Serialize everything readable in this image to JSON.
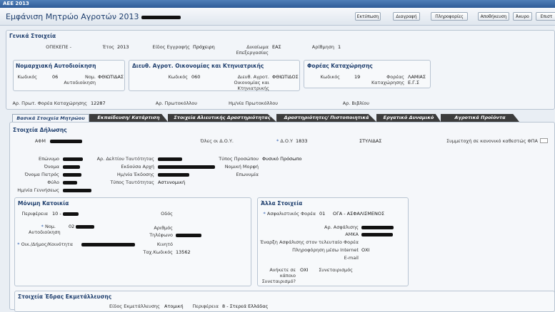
{
  "app": {
    "title": "ΑΕΕ 2013"
  },
  "page": {
    "title": "Εμφάνιση Μητρώο Αγροτών 2013"
  },
  "toolbar": {
    "print": "Εκτύπωση",
    "delete": "Διαγραφή",
    "info": "Πληροφορίες",
    "save": "Αποθήκευση",
    "cancel": "Άκυρο",
    "back": "Επιστ"
  },
  "general": {
    "title": "Γενικά Στοιχεία",
    "opekepe": "ΟΠΕΚΕΠΕ -",
    "year_label": "Έτος",
    "year": "2013",
    "reg_type_label": "Είδος Εγγραφής",
    "reg_type": "Πρόχειρη",
    "processing_right_label": "Δικαίωμα Επεξεργασίας",
    "processing_right": "ΕΑΣ",
    "number_label": "Αρίθμηση",
    "number": "1",
    "prefecture_box_title": "Νομαρχιακή Αυτοδιοίκηση",
    "code_label": "Κωδικός",
    "prefecture_code": "06",
    "prefecture_name_label": "Νομ. Αυτοδιοίκηση",
    "prefecture_name": "ΦΘΙΩΤΙΔΑΣ",
    "directorate_box_title": "Διευθ. Αγροτ. Οικονομίας και Κτηνιατρικής",
    "directorate_code": "060",
    "directorate_name_label": "Διευθ. Αγροτ. Οικονομίας και Κτηνιατρικής",
    "directorate_name": "ΦΘΙΩΤΙΔΟΣ",
    "body_box_title": "Φορέας Καταχώρησης",
    "body_code": "19",
    "body_name_label": "Φορέας Καταχώρησης",
    "body_name": "ΛΑΜΙΑΣ",
    "body_name2": "Ε.Γ.Σ",
    "protocol_body_label": "Αρ. Πρωτ. Φορέα Καταχώρησης",
    "protocol_body": "12287",
    "protocol_label": "Αρ. Πρωτοκόλλου",
    "protocol_date_label": "Ημ/νία Πρωτοκόλλου",
    "book_no_label": "Αρ. Βιβλίου"
  },
  "tabs": [
    "Βασικά Στοιχεία Μητρώου",
    "Εκπαίδευση/ Κατάρτιση",
    "Στοιχεία Αλιευτικής Δραστηριότητας",
    "Δραστηριότητες/ Πιστοποιητικά",
    "Εργατικό Δυναμικό",
    "Αγροτικά Προϊόντα"
  ],
  "declaration": {
    "title": "Στοιχεία Δήλωσης",
    "afm_label": "ΑΦΜ",
    "all_doy_label": "Όλες οι Δ.Ο.Υ.",
    "doy_label": "Δ.Ο.Υ",
    "doy_code": "1833",
    "doy_name": "ΣΤΥΛΙΔΑΣ",
    "regime_label": "Συμμετοχή σε κανονικό καθεστώς ΦΠΑ",
    "surname_label": "Επώνυμο",
    "name_label": "Όνομα",
    "father_label": "Όνομα Πατρός",
    "gender_label": "Φύλο",
    "birthdate_label": "Ημ/νία Γεννήσεως",
    "id_no_label": "Αρ. Δελτίου Ταυτότητας",
    "issuer_label": "Εκδούσα Αρχή",
    "issue_date_label": "Ημ/νία Έκδοσης",
    "id_type_label": "Τύπος Ταυτότητας",
    "id_type": "Αστυνομική",
    "person_type_label": "Τύπος Προσώπου",
    "person_type": "Φυσικό Πρόσωπο",
    "legal_form_label": "Νομική Μορφή",
    "company_name_label": "Επωνυμία"
  },
  "residence": {
    "title": "Μόνιμη Κατοικία",
    "region_label": "Περιφέρεια",
    "region_code": "10 -",
    "street_label": "Οδός",
    "prefecture_label": "Νομ. Αυτοδιοίκηση",
    "prefecture_code": "02",
    "street_no_label": "Αριθμός",
    "phone_label": "Τηλέφωνο",
    "municipality_label": "Οικ./Δήμος/Κοινότητα",
    "mobile_label": "Κινητό",
    "postal_label": "Ταχ.Κωδικός",
    "postal": "13562"
  },
  "other": {
    "title": "Άλλα Στοιχεία",
    "insurer_label": "Ασφαλιστικός Φορέα",
    "insurer_code": "01",
    "insurer_name": "ΟΓΑ - ΑΣΦΑΛΙΣΜΕΝΟΣ",
    "insurance_no_label": "Αρ. Ασφάλισης",
    "amka_label": "ΑΜΚΑ",
    "insurance_start_label": "Έναρξη Ασφάλισης στον τελευταίο Φορέα",
    "internet_info_label": "Πληροφόρηση μέσω Internet",
    "internet_info": "ΟΧΙ",
    "email_label": "E-mail",
    "coop_member_label": "Ανήκετε σε κάποιο Συνεταιρισμό?",
    "coop_member": "ΟΧΙ",
    "coop_label": "Συνεταιρισμός"
  },
  "holding": {
    "title": "Στοιχεία Έδρας Εκμετάλλευσης",
    "type_label": "Είδος Εκμετάλλευσης",
    "type": "Ατομική",
    "region_label": "Περιφέρεια",
    "region": "8 - Στερεά Ελλάδας"
  }
}
